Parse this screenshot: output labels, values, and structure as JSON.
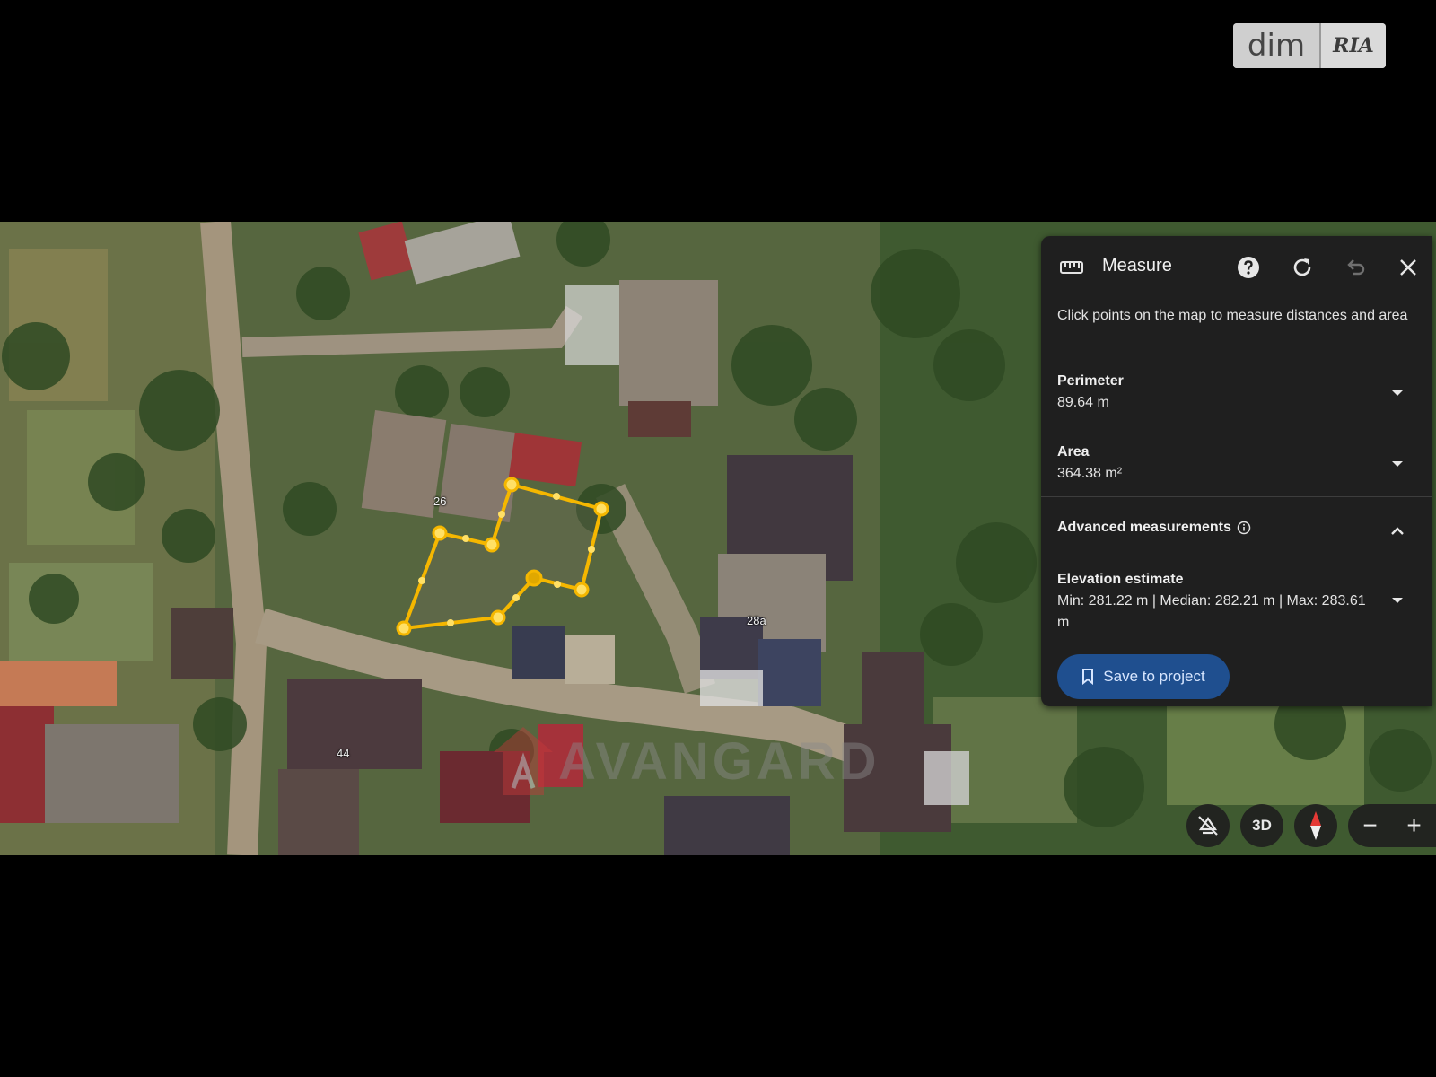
{
  "watermark_logo": {
    "left_text": "dim",
    "right_text": "RIA"
  },
  "map": {
    "house_numbers": [
      "26",
      "28a",
      "44"
    ],
    "photo_watermark": "AVANGARD"
  },
  "measure_panel": {
    "title": "Measure",
    "icons": [
      "ruler-icon",
      "help-icon",
      "refresh-icon",
      "undo-icon",
      "close-icon"
    ],
    "description": "Click points on the map to measure distances and area",
    "perimeter": {
      "label": "Perimeter",
      "value": "89.64 m"
    },
    "area": {
      "label": "Area",
      "value": "364.38 m²"
    },
    "advanced": {
      "label": "Advanced measurements"
    },
    "elevation": {
      "label": "Elevation estimate",
      "value": "Min: 281.22 m | Median: 282.21 m | Max: 283.61 m"
    },
    "save_button": "Save to project"
  },
  "map_controls": {
    "three_d": "3D",
    "zoom_out": "−",
    "zoom_in": "+"
  },
  "colors": {
    "panel_bg": "#1f1f1f",
    "save_button_bg": "#1f4f8f",
    "polygon_stroke": "#f5b700"
  }
}
